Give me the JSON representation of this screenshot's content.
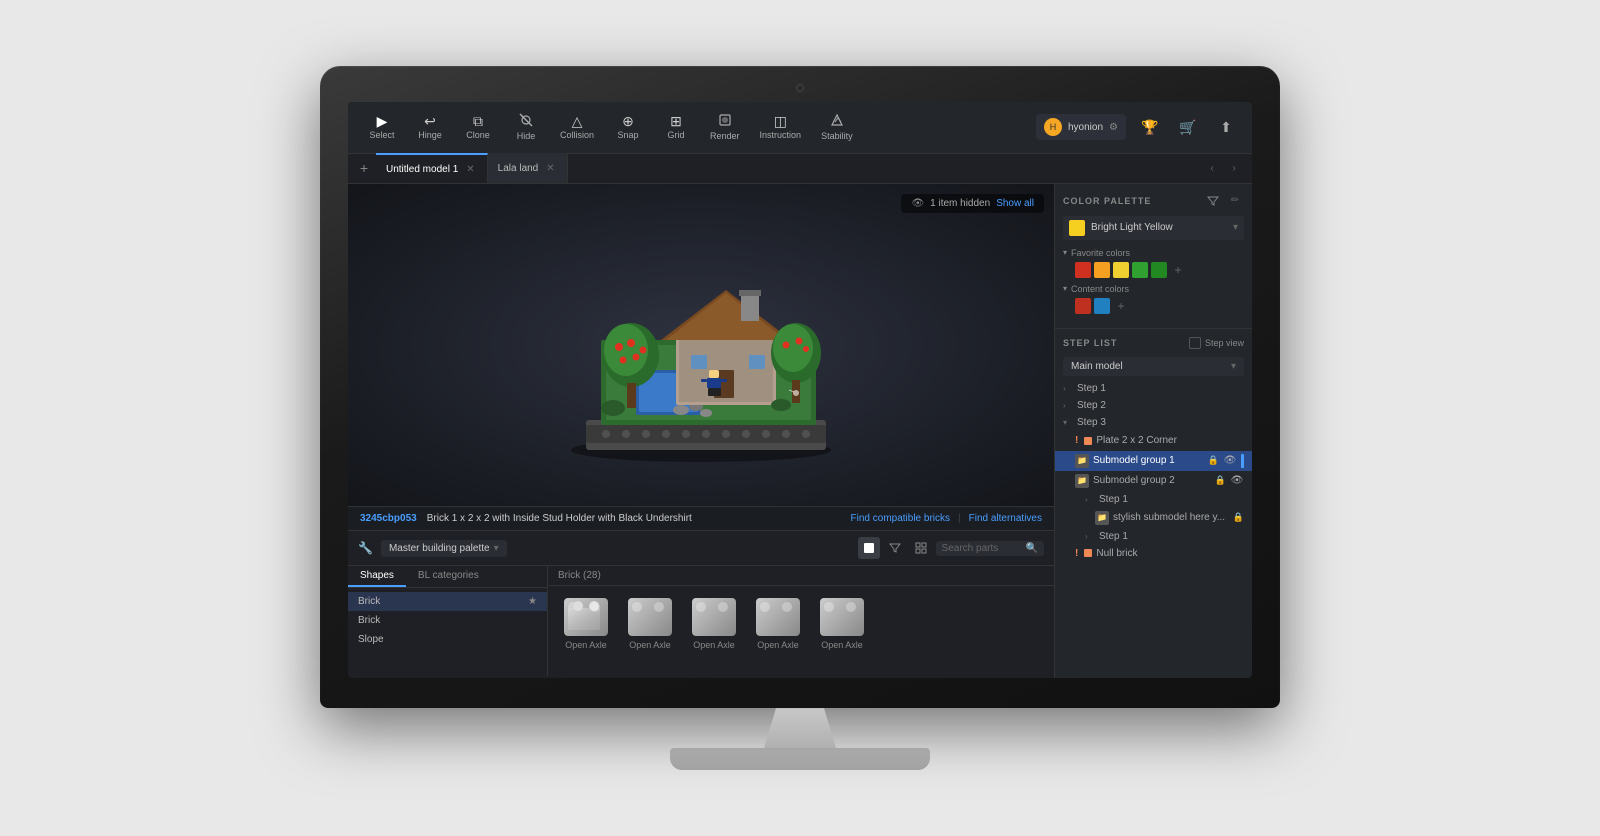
{
  "monitor": {
    "camera_label": "camera"
  },
  "toolbar": {
    "tools": [
      {
        "id": "select",
        "label": "Select",
        "icon": "▶",
        "active": true
      },
      {
        "id": "hinge",
        "label": "Hinge",
        "icon": "↩"
      },
      {
        "id": "clone",
        "label": "Clone",
        "icon": "⧉"
      },
      {
        "id": "hide",
        "label": "Hide",
        "icon": "◉"
      },
      {
        "id": "collision",
        "label": "Collision",
        "icon": "△"
      },
      {
        "id": "snap",
        "label": "Snap",
        "icon": "⊕"
      },
      {
        "id": "grid",
        "label": "Grid",
        "icon": "⊞"
      },
      {
        "id": "render",
        "label": "Render",
        "icon": "⬛"
      },
      {
        "id": "instruction",
        "label": "Instruction",
        "icon": "◫"
      },
      {
        "id": "stability",
        "label": "Stability",
        "icon": "⚡"
      }
    ],
    "user": {
      "name": "hyonion",
      "avatar_color": "#f5a623"
    },
    "icons": [
      "trophy",
      "cart",
      "upload"
    ]
  },
  "tabs": {
    "items": [
      {
        "id": "model1",
        "label": "Untitled model 1",
        "active": true
      },
      {
        "id": "lalaland",
        "label": "Lala land",
        "active": false
      }
    ],
    "add_label": "+"
  },
  "viewport": {
    "hidden_notice": "1 item hidden",
    "show_all_label": "Show all"
  },
  "brick_info": {
    "id": "3245cbp053",
    "name": "Brick 1 x 2 x 2 with Inside Stud Holder with Black Undershirt",
    "link1": "Find compatible bricks",
    "link2": "Find alternatives",
    "separator": "|"
  },
  "palette": {
    "dropdown_label": "Master building palette",
    "search_placeholder": "Search parts",
    "tabs": [
      "Shapes",
      "BL categories"
    ],
    "active_tab": "Shapes",
    "shapes": [
      {
        "label": "Brick",
        "starred": true
      },
      {
        "label": "Brick",
        "starred": false
      },
      {
        "label": "Slope",
        "starred": false
      }
    ],
    "brick_count_label": "Brick (28)",
    "bricks": [
      {
        "label": "Open Axle"
      },
      {
        "label": "Open Axle"
      },
      {
        "label": "Open Axle"
      },
      {
        "label": "Open Axle"
      },
      {
        "label": "Open Axle"
      }
    ]
  },
  "right_panel": {
    "color_palette_title": "COLOR PALETTE",
    "selected_color": {
      "name": "Bright Light Yellow",
      "hex": "#f5d020"
    },
    "favorite_colors_label": "Favorite colors",
    "favorite_colors": [
      "#d03020",
      "#f5a020",
      "#f0d030",
      "#30a030",
      "#30a030"
    ],
    "content_colors_label": "Content colors",
    "content_colors": [
      "#c03020",
      "#2080c0"
    ],
    "step_list_title": "STEP LIST",
    "step_view_label": "Step view",
    "model_dropdown": "Main model",
    "steps": [
      {
        "type": "collapsible",
        "label": "Step 1",
        "level": 0,
        "expanded": false
      },
      {
        "type": "collapsible",
        "label": "Step 2",
        "level": 0,
        "expanded": false
      },
      {
        "type": "collapsible",
        "label": "Step 3",
        "level": 0,
        "expanded": true,
        "children": [
          {
            "type": "item",
            "label": "Plate 2 x 2 Corner",
            "warning": true,
            "level": 1
          },
          {
            "type": "item",
            "label": "Submodel group 1",
            "highlighted": true,
            "level": 1,
            "icon": "folder",
            "locked": true
          },
          {
            "type": "item",
            "label": "Submodel group 2",
            "level": 1,
            "icon": "folder",
            "locked": true
          },
          {
            "type": "collapsible",
            "label": "Step 1",
            "level": 2,
            "expanded": false,
            "children": [
              {
                "type": "item",
                "label": "stylish submodel here y...",
                "level": 3,
                "icon": "folder",
                "locked": true
              }
            ]
          },
          {
            "type": "collapsible",
            "label": "Step 1",
            "level": 2,
            "expanded": false
          },
          {
            "type": "item",
            "label": "Null brick",
            "warning": true,
            "level": 1
          }
        ]
      }
    ]
  }
}
